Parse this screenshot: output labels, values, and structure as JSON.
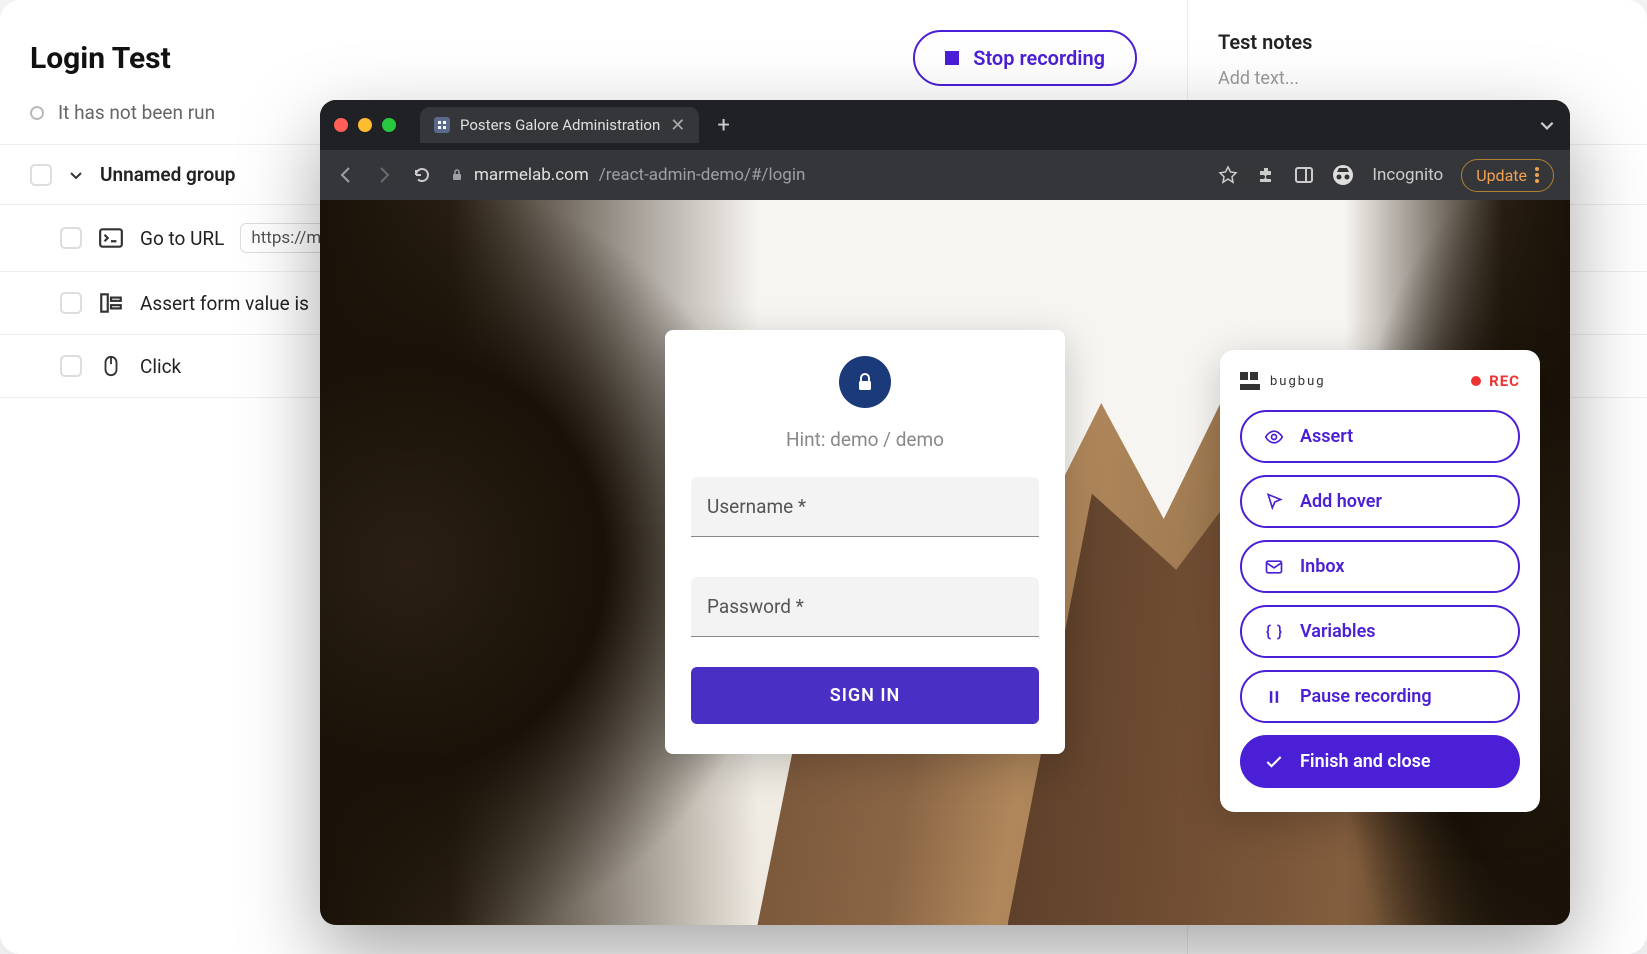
{
  "app": {
    "title": "Login Test",
    "stop_button": "Stop recording",
    "status": "It has not been run",
    "notes_title": "Test notes",
    "notes_placeholder": "Add text..."
  },
  "steps": {
    "group_name": "Unnamed group",
    "items": [
      {
        "label": "Go to URL",
        "value": "https://m"
      },
      {
        "label": "Assert form value is"
      },
      {
        "label": "Click"
      }
    ]
  },
  "browser": {
    "tab_title": "Posters Galore Administration",
    "url_domain": "marmelab.com",
    "url_path": "/react-admin-demo/#/login",
    "incognito": "Incognito",
    "update": "Update"
  },
  "login": {
    "hint": "Hint: demo / demo",
    "username_label": "Username *",
    "password_label": "Password *",
    "signin": "SIGN IN"
  },
  "bugbug": {
    "logo_text": "bugbug",
    "rec": "REC",
    "buttons": {
      "assert": "Assert",
      "hover": "Add hover",
      "inbox": "Inbox",
      "vars": "Variables",
      "pause": "Pause recording",
      "finish": "Finish and close"
    }
  }
}
